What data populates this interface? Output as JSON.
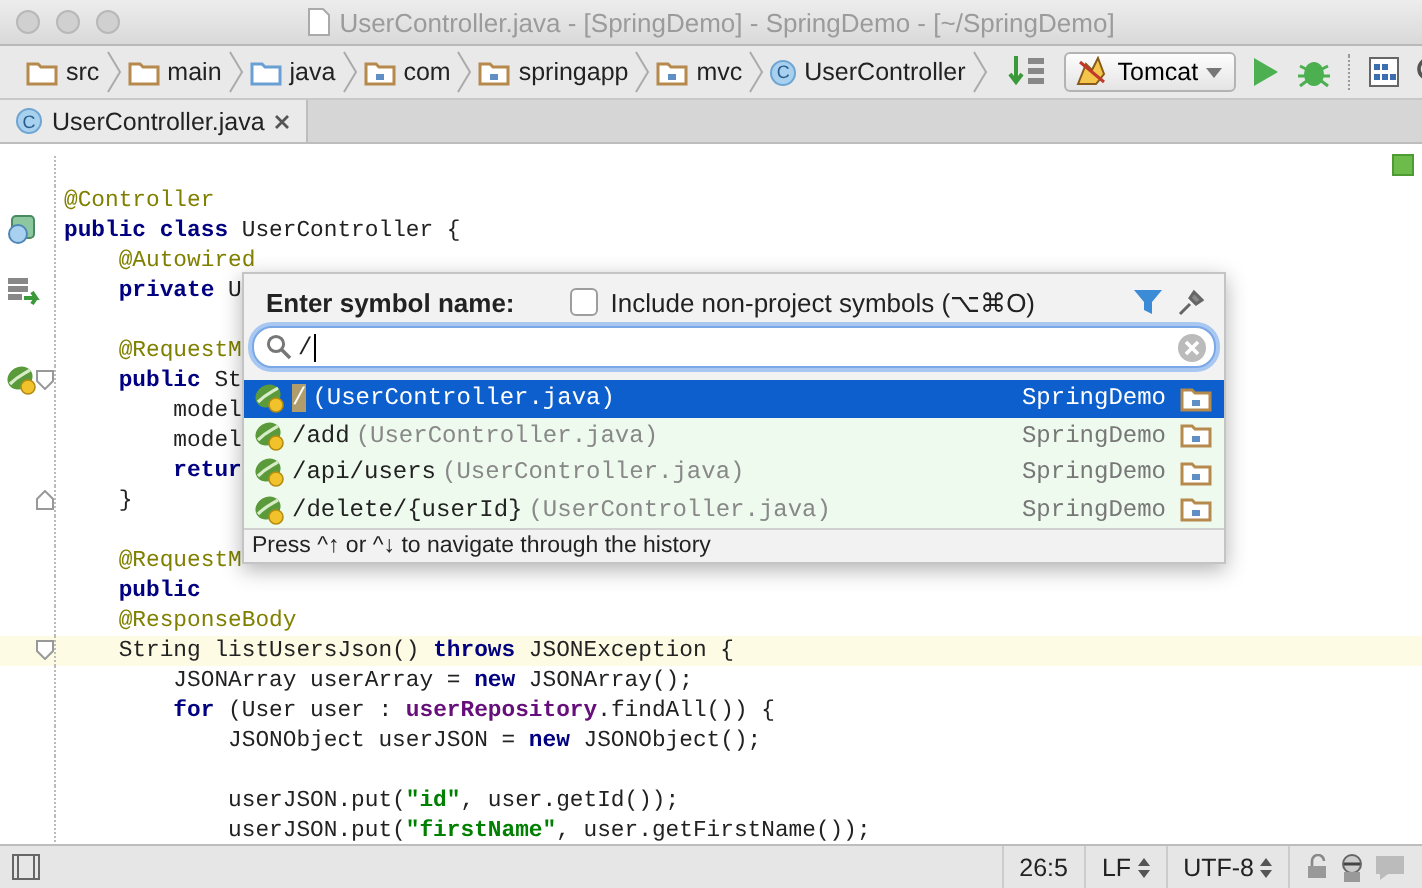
{
  "window": {
    "title": "UserController.java - [SpringDemo] - SpringDemo - [~/SpringDemo]"
  },
  "breadcrumbs": [
    {
      "label": "src",
      "kind": "folder"
    },
    {
      "label": "main",
      "kind": "folder"
    },
    {
      "label": "java",
      "kind": "source-folder"
    },
    {
      "label": "com",
      "kind": "package"
    },
    {
      "label": "springapp",
      "kind": "package"
    },
    {
      "label": "mvc",
      "kind": "package"
    },
    {
      "label": "UserController",
      "kind": "class",
      "icon_letter": "C"
    }
  ],
  "run_config": {
    "label": "Tomcat"
  },
  "tabs": [
    {
      "label": "UserController.java",
      "icon_letter": "C",
      "selected": true
    }
  ],
  "code": [
    {
      "kind": "blank"
    },
    {
      "kind": "code",
      "tokens": [
        {
          "text": "@Controller",
          "kind": "annotation"
        }
      ]
    },
    {
      "kind": "code",
      "gutter": [
        {
          "kind": "class"
        }
      ],
      "tokens": [
        {
          "text": "public class ",
          "kind": "keyword"
        },
        {
          "text": "UserController {",
          "kind": "plain"
        }
      ]
    },
    {
      "kind": "code",
      "tokens": [
        {
          "text": "    @Autowired",
          "kind": "annotation"
        }
      ]
    },
    {
      "kind": "code",
      "gutter": [
        {
          "kind": "injection"
        }
      ],
      "tokens": [
        {
          "text": "    private ",
          "kind": "keyword"
        },
        {
          "text": "U",
          "kind": "plain"
        }
      ]
    },
    {
      "kind": "blank"
    },
    {
      "kind": "code",
      "tokens": [
        {
          "text": "    @RequestM",
          "kind": "annotation"
        }
      ]
    },
    {
      "kind": "code",
      "gutter": [
        {
          "kind": "bean"
        },
        {
          "kind": "fold-start"
        }
      ],
      "tokens": [
        {
          "text": "    public ",
          "kind": "keyword"
        },
        {
          "text": "St",
          "kind": "plain"
        }
      ]
    },
    {
      "kind": "code",
      "tokens": [
        {
          "text": "        model",
          "kind": "plain"
        }
      ]
    },
    {
      "kind": "code",
      "tokens": [
        {
          "text": "        model",
          "kind": "plain"
        }
      ]
    },
    {
      "kind": "code",
      "tokens": [
        {
          "text": "        retur",
          "kind": "keyword"
        }
      ]
    },
    {
      "kind": "code",
      "gutter": [
        {
          "kind": "fold-end"
        }
      ],
      "tokens": [
        {
          "text": "    }",
          "kind": "plain"
        }
      ]
    },
    {
      "kind": "blank"
    },
    {
      "kind": "code",
      "tokens": [
        {
          "text": "    @RequestM",
          "kind": "annotation"
        }
      ]
    },
    {
      "kind": "code",
      "tokens": [
        {
          "text": "    public",
          "kind": "keyword"
        }
      ]
    },
    {
      "kind": "code",
      "tokens": [
        {
          "text": "    @ResponseBody",
          "kind": "annotation"
        }
      ]
    },
    {
      "kind": "code",
      "current": true,
      "gutter": [
        {
          "kind": "fold-start"
        }
      ],
      "tokens": [
        {
          "text": "    String listUsersJson() ",
          "kind": "plain"
        },
        {
          "text": "throws ",
          "kind": "keyword"
        },
        {
          "text": "JSONException {",
          "kind": "plain"
        }
      ]
    },
    {
      "kind": "code",
      "tokens": [
        {
          "text": "        JSONArray userArray = ",
          "kind": "plain"
        },
        {
          "text": "new ",
          "kind": "keyword"
        },
        {
          "text": "JSONArray();",
          "kind": "plain"
        }
      ]
    },
    {
      "kind": "code",
      "tokens": [
        {
          "text": "        for ",
          "kind": "keyword"
        },
        {
          "text": "(User user : ",
          "kind": "plain"
        },
        {
          "text": "userRepository",
          "kind": "field"
        },
        {
          "text": ".findAll()) {",
          "kind": "plain"
        }
      ]
    },
    {
      "kind": "code",
      "tokens": [
        {
          "text": "            JSONObject userJSON = ",
          "kind": "plain"
        },
        {
          "text": "new ",
          "kind": "keyword"
        },
        {
          "text": "JSONObject();",
          "kind": "plain"
        }
      ]
    },
    {
      "kind": "blank"
    },
    {
      "kind": "code",
      "tokens": [
        {
          "text": "            userJSON.put(",
          "kind": "plain"
        },
        {
          "text": "\"id\"",
          "kind": "string"
        },
        {
          "text": ", user.getId());",
          "kind": "plain"
        }
      ]
    },
    {
      "kind": "code",
      "tokens": [
        {
          "text": "            userJSON.put(",
          "kind": "plain"
        },
        {
          "text": "\"firstName\"",
          "kind": "string"
        },
        {
          "text": ", user.getFirstName());",
          "kind": "plain"
        }
      ]
    }
  ],
  "symbol_popup": {
    "title": "Enter symbol name:",
    "include_option": {
      "label": "Include non-project symbols (⌥⌘O)",
      "checked": false
    },
    "query": "/",
    "results": [
      {
        "path": "/",
        "file": "(UserController.java)",
        "project": "SpringDemo",
        "selected": true,
        "match_highlighted": true
      },
      {
        "path": "/add",
        "file": "(UserController.java)",
        "project": "SpringDemo",
        "selected": false,
        "match_highlighted": false
      },
      {
        "path": "/api/users",
        "file": "(UserController.java)",
        "project": "SpringDemo",
        "selected": false,
        "match_highlighted": false
      },
      {
        "path": "/delete/{userId}",
        "file": "(UserController.java)",
        "project": "SpringDemo",
        "selected": false,
        "match_highlighted": false
      }
    ],
    "hint": "Press ^↑ or ^↓ to navigate through the history"
  },
  "status_bar": {
    "position": "26:5",
    "line_separator": "LF",
    "encoding": "UTF-8"
  }
}
